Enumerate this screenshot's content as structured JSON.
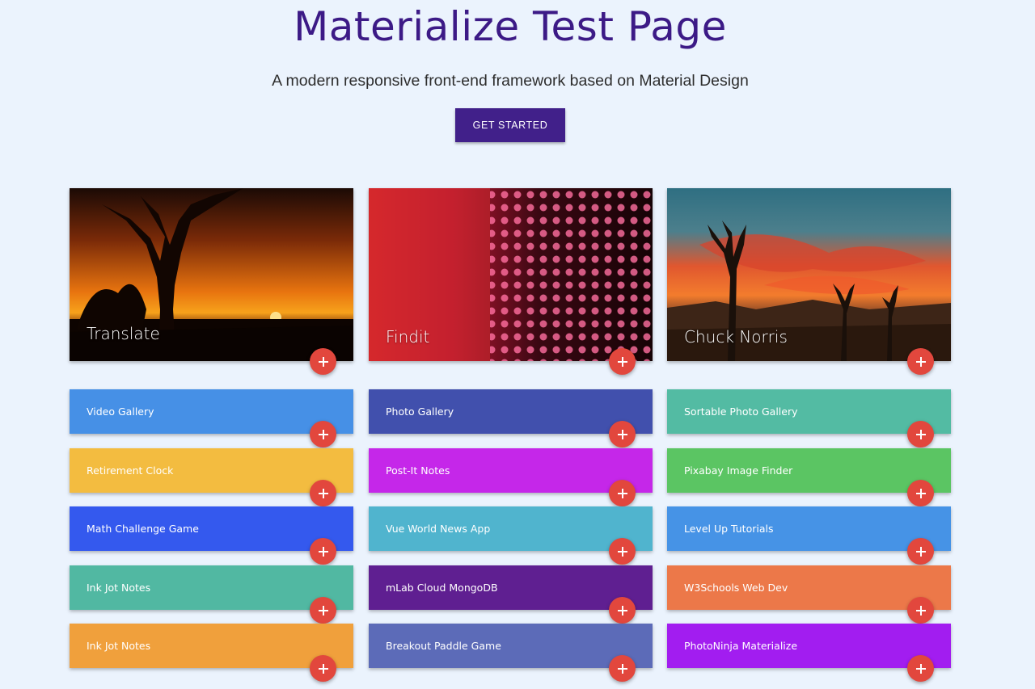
{
  "header": {
    "title": "Materialize Test Page",
    "subtitle": "A modern responsive front-end framework based on Material Design",
    "cta_label": "GET STARTED"
  },
  "image_cards": [
    {
      "title": "Translate",
      "scene": "savanna-sunset"
    },
    {
      "title": "Findit",
      "scene": "led-wall"
    },
    {
      "title": "Chuck Norris",
      "scene": "desert-sunset"
    }
  ],
  "columns": [
    {
      "items": [
        {
          "label": "Video Gallery",
          "color": "#4690e6"
        },
        {
          "label": "Retirement Clock",
          "color": "#f3bc40"
        },
        {
          "label": "Math Challenge Game",
          "color": "#3459ee"
        },
        {
          "label": "Ink Jot Notes",
          "color": "#51b8a2"
        },
        {
          "label": "Ink Jot Notes",
          "color": "#f0a03c"
        }
      ]
    },
    {
      "items": [
        {
          "label": "Photo Gallery",
          "color": "#4150ad"
        },
        {
          "label": "Post-It Notes",
          "color": "#c527e9"
        },
        {
          "label": "Vue World News App",
          "color": "#50b4ce"
        },
        {
          "label": "mLab Cloud MongoDB",
          "color": "#5f1f91"
        },
        {
          "label": "Breakout Paddle Game",
          "color": "#5c6bb8"
        }
      ]
    },
    {
      "items": [
        {
          "label": "Sortable Photo Gallery",
          "color": "#53bba3"
        },
        {
          "label": "Pixabay Image Finder",
          "color": "#5bc563"
        },
        {
          "label": "Level Up Tutorials",
          "color": "#4693e6"
        },
        {
          "label": "W3Schools Web Dev",
          "color": "#ec7849"
        },
        {
          "label": "PhotoNinja Materialize",
          "color": "#a21df0"
        }
      ]
    }
  ],
  "add_button_icon": "plus-icon",
  "colors": {
    "page_background": "#ebf3fd",
    "title": "#3c1a86",
    "cta_background": "#41208a",
    "fab": "#e2473d"
  }
}
